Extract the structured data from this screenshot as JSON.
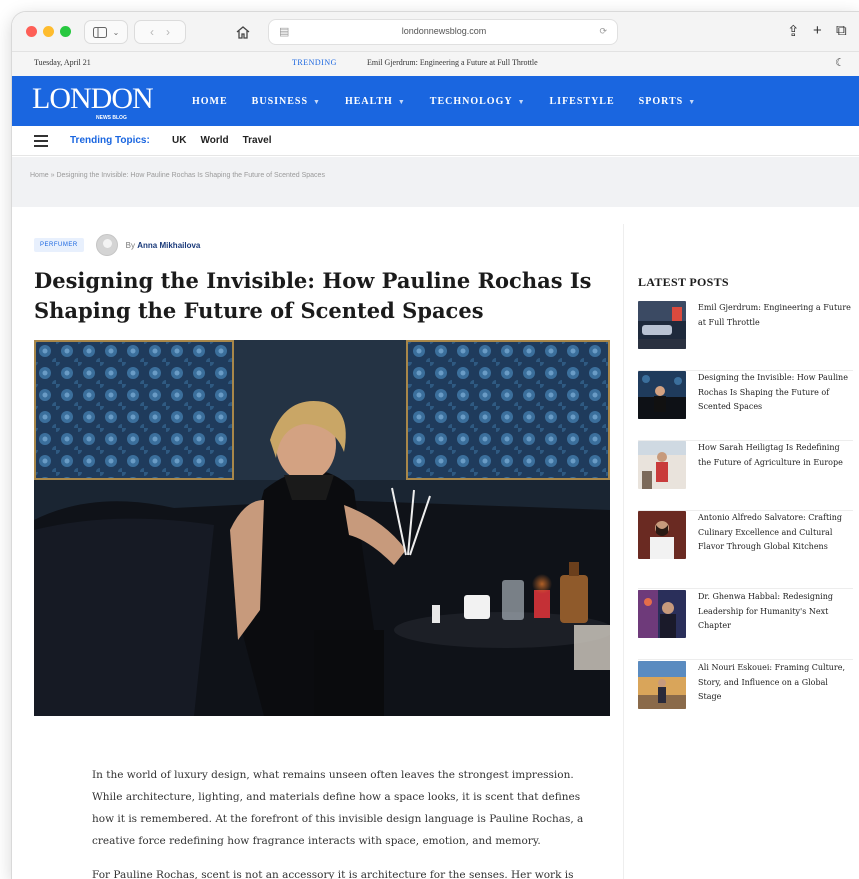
{
  "browser": {
    "url": "londonnewsblog.com",
    "reader_icon": "reader-icon",
    "reload_icon": "reload-icon"
  },
  "topbar": {
    "date": "Tuesday, April 21",
    "trending_label": "TRENDING",
    "trending_headline": "Emil Gjerdrum: Engineering a Future at Full Throttle"
  },
  "brand": {
    "logo": "LONDON",
    "logo_sub": "NEWS BLOG",
    "accent_color": "#1a66e0"
  },
  "nav": {
    "items": [
      {
        "label": "HOME"
      },
      {
        "label": "BUSINESS"
      },
      {
        "label": "HEALTH"
      },
      {
        "label": "TECHNOLOGY"
      },
      {
        "label": "LIFESTYLE"
      },
      {
        "label": "SPORTS"
      }
    ]
  },
  "topics": {
    "label": "Trending Topics:",
    "items": [
      "UK",
      "World",
      "Travel"
    ]
  },
  "breadcrumb": "Home » Designing the Invisible: How Pauline Rochas Is Shaping the Future of Scented Spaces",
  "article": {
    "category": "PERFUMER",
    "by": "By",
    "author": "Anna Mikhailova",
    "title": "Designing the Invisible: How Pauline Rochas Is Shaping the Future of Scented Spaces",
    "paragraphs": [
      "In the world of luxury design, what remains unseen often leaves the strongest impression. While architecture, lighting, and materials define how a space looks, it is scent that defines how it is remembered. At the forefront of this invisible design language is Pauline Rochas, a creative force redefining how fragrance interacts with space, emotion, and memory.",
      "For Pauline Rochas, scent is not an accessory it is architecture for the senses. Her work is"
    ]
  },
  "sidebar": {
    "title": "LATEST POSTS",
    "posts": [
      {
        "title": "Emil Gjerdrum: Engineering a Future at Full Throttle"
      },
      {
        "title": "Designing the Invisible: How Pauline Rochas Is Shaping the Future of Scented Spaces"
      },
      {
        "title": "How Sarah Heiligtag Is Redefining the Future of Agriculture in Europe"
      },
      {
        "title": "Antonio Alfredo Salvatore: Crafting Culinary Excellence and Cultural Flavor Through Global Kitchens"
      },
      {
        "title": "Dr. Ghenwa Habbal: Redesigning Leadership for Humanity's Next Chapter"
      },
      {
        "title": "Ali Nouri Eskouei: Framing Culture, Story, and Influence on a Global Stage"
      }
    ]
  }
}
